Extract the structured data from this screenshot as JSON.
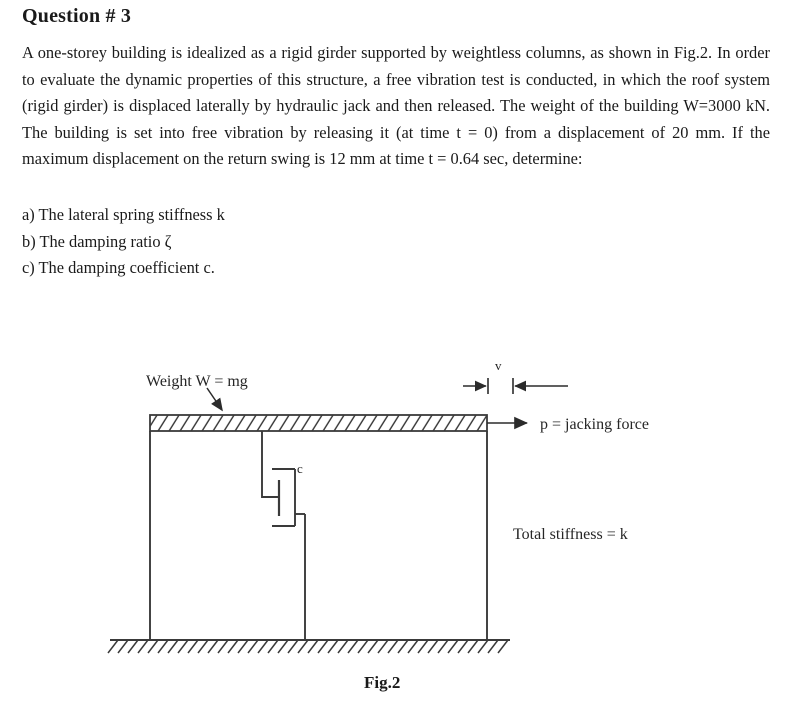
{
  "question": {
    "title": "Question # 3",
    "body": "A one-storey building is idealized as a rigid girder supported by weightless columns, as shown in Fig.2. In order to evaluate the dynamic properties of this structure, a free vibration test is conducted, in which the roof system (rigid girder) is displaced laterally by hydraulic jack and then released. The weight of the building W=3000 kN. The building is set into free vibration by releasing it (at time t = 0) from a displacement of 20 mm. If the maximum displacement on the return swing is 12 mm at time t = 0.64 sec, determine:",
    "parts": [
      "a) The lateral spring stiffness k",
      "b) The damping ratio ζ",
      "c) The damping coefficient c."
    ],
    "given": {
      "weight_label": "W",
      "weight_value": "3000 kN",
      "initial_displacement": "20 mm",
      "return_displacement": "12 mm",
      "return_time": "0.64 sec"
    }
  },
  "figure": {
    "caption": "Fig.2",
    "labels": {
      "weight": "Weight W = mg",
      "damper": "c",
      "displacement": "v",
      "force": "p = jacking force",
      "stiffness": "Total stiffness = k"
    },
    "colors": {
      "line": "#3a3a3a",
      "text": "#262626",
      "background": "#ffffff"
    }
  }
}
